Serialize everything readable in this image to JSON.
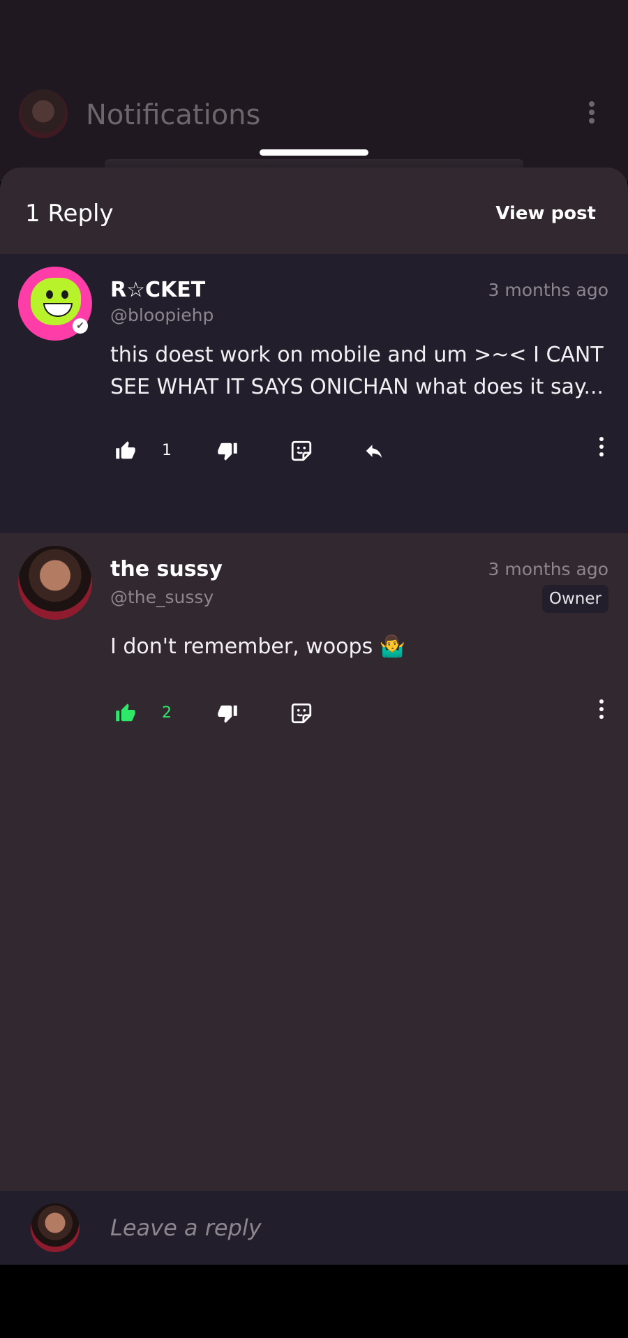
{
  "background": {
    "title": "Notifications"
  },
  "sheet": {
    "reply_count": "1 Reply",
    "view_post": "View post"
  },
  "comments": [
    {
      "name": "R☆CKET",
      "handle": "@bloopiehp",
      "time": "3 months ago",
      "body": "this doest work on mobile and um >~< I CANT SEE WHAT IT SAYS ONICHAN what does it say...",
      "likes": "1",
      "like_color": "#ffffff"
    },
    {
      "name": "the sussy",
      "handle": "@the_sussy",
      "time": "3 months ago",
      "badge": "Owner",
      "body": "I don't remember, woops 🤷‍♂️",
      "likes": "2",
      "like_color": "#2ee86a"
    }
  ],
  "reply_bar": {
    "placeholder": "Leave a reply"
  },
  "icons": [
    "thumbs-up-icon",
    "thumbs-down-icon",
    "sticker-reply-icon",
    "reply-arrow-icon",
    "more-vertical-icon"
  ]
}
